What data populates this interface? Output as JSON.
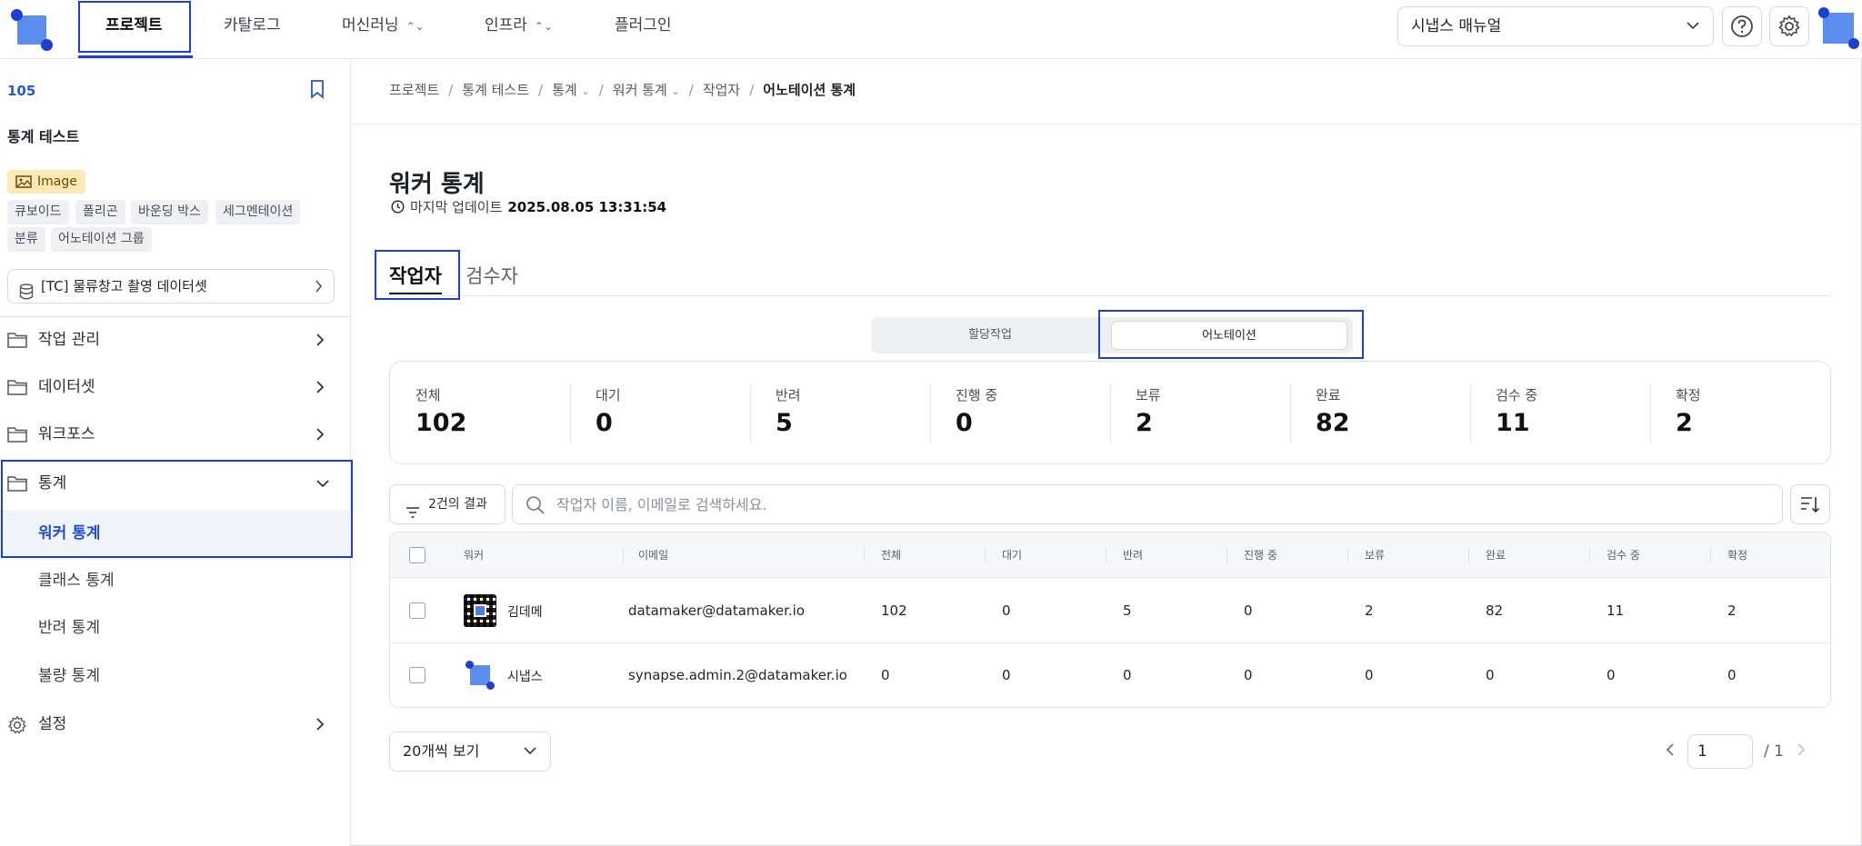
{
  "nav": {
    "items": [
      {
        "label": "프로젝트",
        "active": true
      },
      {
        "label": "카탈로그"
      },
      {
        "label": "머신러닝",
        "chevron": true
      },
      {
        "label": "인프라",
        "chevron": true
      },
      {
        "label": "플러그인"
      }
    ],
    "manual_select": "시냅스 매뉴얼"
  },
  "sidebar": {
    "project_id": "105",
    "project_name": "통계 테스트",
    "data_type": "Image",
    "tags": [
      "큐보이드",
      "폴리곤",
      "바운딩 박스",
      "세그멘테이션",
      "분류",
      "어노테이션 그룹"
    ],
    "dataset": "[TC] 물류창고 촬영 데이터셋",
    "menu": [
      {
        "label": "작업 관리"
      },
      {
        "label": "데이터셋"
      },
      {
        "label": "워크포스"
      },
      {
        "label": "통계",
        "expanded": true
      },
      {
        "label": "설정"
      }
    ],
    "stats_sub": [
      "워커 통계",
      "클래스 통계",
      "반려 통계",
      "불량 통계"
    ]
  },
  "breadcrumb": [
    "프로젝트",
    "통계 테스트",
    "통계",
    "워커 통계",
    "작업자",
    "어노테이션 통계"
  ],
  "page": {
    "title": "워커 통계",
    "updated_label": "마지막 업데이트",
    "updated_value": "2025.08.05 13:31:54"
  },
  "tabs": [
    "작업자",
    "검수자"
  ],
  "segment": [
    "할당작업",
    "어노테이션"
  ],
  "stats": [
    {
      "label": "전체",
      "value": "102"
    },
    {
      "label": "대기",
      "value": "0"
    },
    {
      "label": "반려",
      "value": "5"
    },
    {
      "label": "진행 중",
      "value": "0"
    },
    {
      "label": "보류",
      "value": "2"
    },
    {
      "label": "완료",
      "value": "82"
    },
    {
      "label": "검수 중",
      "value": "11"
    },
    {
      "label": "확정",
      "value": "2"
    }
  ],
  "toolbar": {
    "result_label": "2건의 결과",
    "search_placeholder": "작업자 이름, 이메일로 검색하세요."
  },
  "table": {
    "headers": [
      "워커",
      "이메일",
      "전체",
      "대기",
      "반려",
      "진행 중",
      "보류",
      "완료",
      "검수 중",
      "확정"
    ],
    "rows": [
      {
        "name": "김데메",
        "email": "datamaker@datamaker.io",
        "values": [
          "102",
          "0",
          "5",
          "0",
          "2",
          "82",
          "11",
          "2"
        ]
      },
      {
        "name": "시냅스",
        "email": "synapse.admin.2@datamaker.io",
        "values": [
          "0",
          "0",
          "0",
          "0",
          "0",
          "0",
          "0",
          "0"
        ]
      }
    ]
  },
  "pagination": {
    "per_page": "20개씩 보기",
    "current": "1",
    "total": "/ 1"
  },
  "colors": {
    "accent": "#1d3fd6",
    "brand": "#5b8def"
  }
}
